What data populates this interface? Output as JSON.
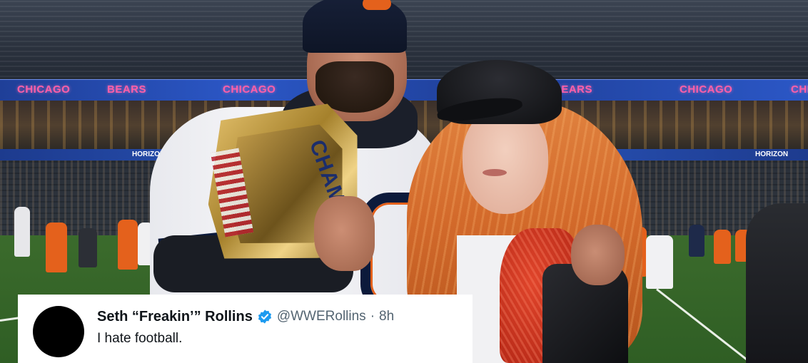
{
  "stadium": {
    "banner_texts": [
      "CHICAGO",
      "BEARS",
      "CHICAGO",
      "CHICAGO",
      "BEARS",
      "CHICAGO"
    ],
    "ribbon_texts": [
      "HORIZON",
      "HORIZON"
    ],
    "belt_text": "CHAMPION"
  },
  "tweet": {
    "display_name": "Seth “Freakin’” Rollins",
    "handle": "@WWERollins",
    "separator": "·",
    "time": "8h",
    "text": "I hate football.",
    "avatar_color": "#000000",
    "verified_color": "#1d9bf0",
    "verified_icon": "verified-badge-icon"
  },
  "colors": {
    "bears_navy": "#0c1a3b",
    "bears_orange": "#e4611c",
    "banner_blue": "#2b57c6",
    "banner_pink": "#ff5fa8"
  }
}
